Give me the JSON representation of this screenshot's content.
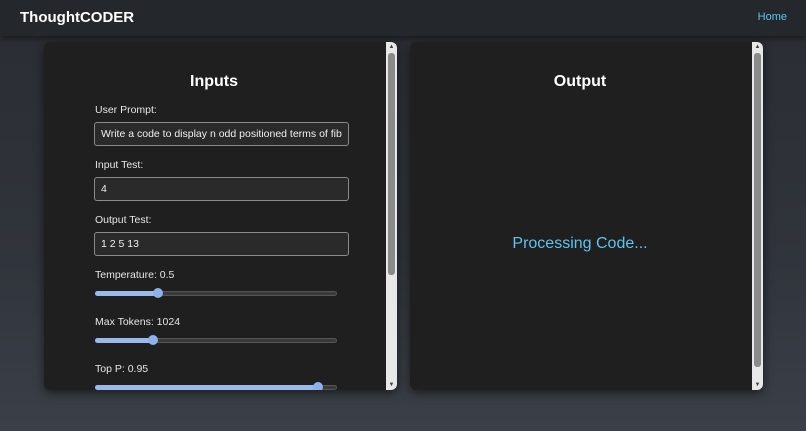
{
  "app": {
    "brand": "ThoughtCODER",
    "nav_home": "Home"
  },
  "inputs": {
    "title": "Inputs",
    "user_prompt": {
      "label": "User Prompt:",
      "value": "Write a code to display n odd positioned terms of fibonacci series"
    },
    "input_test": {
      "label": "Input Test:",
      "value": "4"
    },
    "output_test": {
      "label": "Output Test:",
      "value": "1 2 5 13"
    },
    "temperature": {
      "label_prefix": "Temperature: ",
      "value": "0.5",
      "fraction": 0.26
    },
    "max_tokens": {
      "label_prefix": "Max Tokens: ",
      "value": "1024",
      "fraction": 0.24
    },
    "top_p": {
      "label_prefix": "Top P: ",
      "value": "0.95",
      "fraction": 0.92
    }
  },
  "output": {
    "title": "Output",
    "status": "Processing Code..."
  },
  "colors": {
    "accent": "#5fc3ee",
    "slider": "#9ab8ea",
    "panel": "#1f1f1f"
  }
}
